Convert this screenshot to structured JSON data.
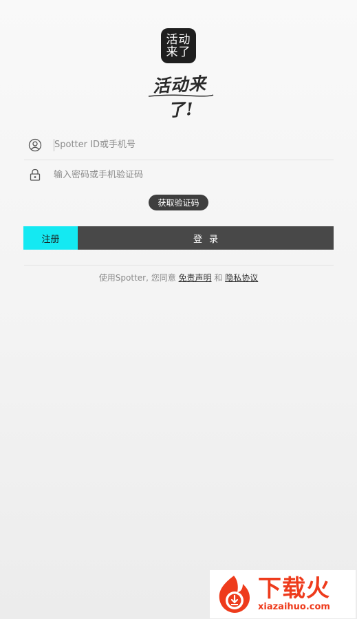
{
  "app": {
    "icon_text": "活动来了",
    "brand_title": "活动来了!"
  },
  "login_form": {
    "username_placeholder": "Spotter ID或手机号",
    "password_placeholder": "输入密码或手机验证码",
    "get_code_label": "获取验证码",
    "register_label": "注册",
    "login_label": "登录"
  },
  "terms": {
    "prefix": "使用Spotter, 您同意 ",
    "disclaimer_link": "免责声明",
    "conjunction": " 和 ",
    "privacy_link": "隐私协议"
  },
  "colors": {
    "register_accent": "#14e9f2",
    "login_bg": "#484848",
    "watermark_brand": "#ee3b1c"
  },
  "icons": {
    "username": "user-circle-icon",
    "password": "padlock-icon",
    "watermark": "download-fire-logo-icon"
  },
  "watermark": {
    "brand_cn": "下载火",
    "url": "xiazaihuo.com"
  }
}
